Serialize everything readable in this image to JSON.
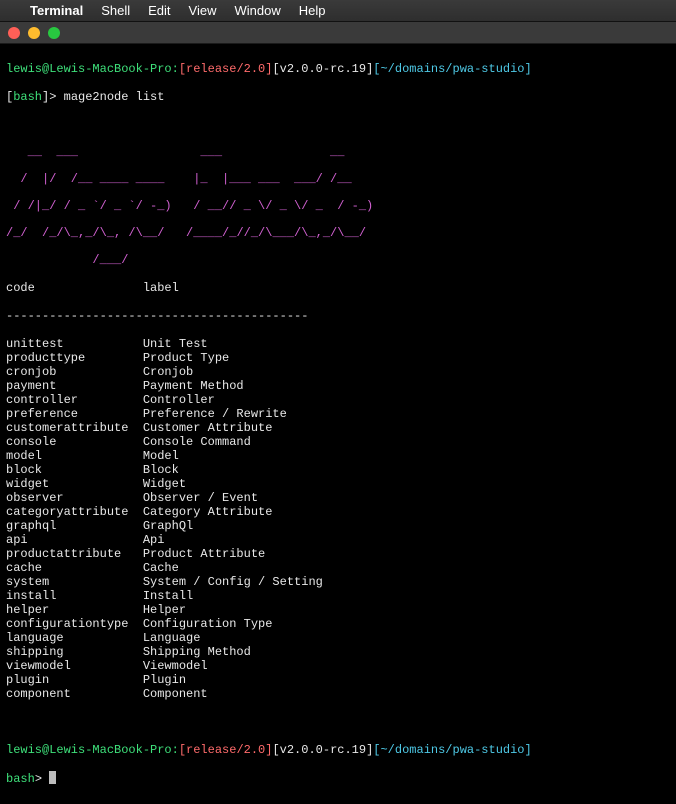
{
  "menubar": {
    "apple": "",
    "appname": "Terminal",
    "items": [
      "Shell",
      "Edit",
      "View",
      "Window",
      "Help"
    ]
  },
  "prompt1": {
    "userhost": "lewis@Lewis-MacBook-Pro:",
    "branch": "[release/2.0]",
    "version": "[v2.0.0-rc.19]",
    "path": "[~/domains/pwa-studio]"
  },
  "shell_line": {
    "open": "[",
    "shell": "bash",
    "close": "]> ",
    "command": "mage2node list"
  },
  "ascii": [
    "   __  ___                 ___               __   ",
    "  /  |/  /__ ____ ____    |_  |___ ___  ___/ /__ ",
    " / /|_/ / _ `/ _ `/ -_)   / __// _ \\/ _ \\/ _  / -_)",
    "/_/  /_/\\_,_/\\_, /\\__/   /____/_//_/\\___/\\_,_/\\__/ ",
    "            /___/                                  "
  ],
  "header": {
    "code": "code",
    "label": "label"
  },
  "divider": {
    "code": "-------------------",
    "label": "-----------------------"
  },
  "rows": [
    {
      "code": "unittest",
      "label": "Unit Test"
    },
    {
      "code": "producttype",
      "label": "Product Type"
    },
    {
      "code": "cronjob",
      "label": "Cronjob"
    },
    {
      "code": "payment",
      "label": "Payment Method"
    },
    {
      "code": "controller",
      "label": "Controller"
    },
    {
      "code": "preference",
      "label": "Preference / Rewrite"
    },
    {
      "code": "customerattribute",
      "label": "Customer Attribute"
    },
    {
      "code": "console",
      "label": "Console Command"
    },
    {
      "code": "model",
      "label": "Model"
    },
    {
      "code": "block",
      "label": "Block"
    },
    {
      "code": "widget",
      "label": "Widget"
    },
    {
      "code": "observer",
      "label": "Observer / Event"
    },
    {
      "code": "categoryattribute",
      "label": "Category Attribute"
    },
    {
      "code": "graphql",
      "label": "GraphQl"
    },
    {
      "code": "api",
      "label": "Api"
    },
    {
      "code": "productattribute",
      "label": "Product Attribute"
    },
    {
      "code": "cache",
      "label": "Cache"
    },
    {
      "code": "system",
      "label": "System / Config / Setting"
    },
    {
      "code": "install",
      "label": "Install"
    },
    {
      "code": "helper",
      "label": "Helper"
    },
    {
      "code": "configurationtype",
      "label": "Configuration Type"
    },
    {
      "code": "language",
      "label": "Language"
    },
    {
      "code": "shipping",
      "label": "Shipping Method"
    },
    {
      "code": "viewmodel",
      "label": "Viewmodel"
    },
    {
      "code": "plugin",
      "label": "Plugin"
    },
    {
      "code": "component",
      "label": "Component"
    }
  ],
  "prompt2": {
    "userhost": "lewis@Lewis-MacBook-Pro:",
    "branch": "[release/2.0]",
    "version": "[v2.0.0-rc.19]",
    "path": "[~/domains/pwa-studio]"
  },
  "shell_line2": {
    "shell": "bash",
    "close": "> "
  }
}
